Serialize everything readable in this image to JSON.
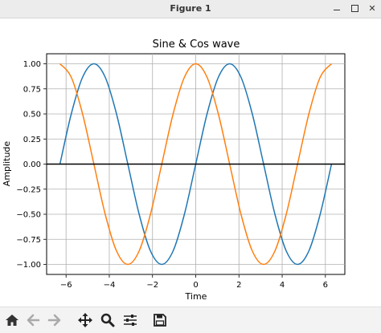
{
  "window": {
    "title": "Figure 1"
  },
  "toolbar": {
    "buttons": [
      {
        "name": "home-button",
        "icon": "home-icon"
      },
      {
        "name": "back-button",
        "icon": "arrow-left-icon"
      },
      {
        "name": "forward-button",
        "icon": "arrow-right-icon"
      },
      {
        "name": "pan-button",
        "icon": "move-icon"
      },
      {
        "name": "zoom-button",
        "icon": "magnifier-icon"
      },
      {
        "name": "configure-subplots-button",
        "icon": "sliders-icon"
      },
      {
        "name": "save-button",
        "icon": "floppy-disk-icon"
      }
    ]
  },
  "chart_data": {
    "type": "line",
    "title": "Sine & Cos wave",
    "xlabel": "Time",
    "ylabel": "Amplitude",
    "xlim": [
      -6.9,
      6.9
    ],
    "ylim": [
      -1.1,
      1.1
    ],
    "xticks": [
      -6,
      -4,
      -2,
      0,
      2,
      4,
      6
    ],
    "xtick_labels": [
      "−6",
      "−4",
      "−2",
      "0",
      "2",
      "4",
      "6"
    ],
    "yticks": [
      1.0,
      0.75,
      0.5,
      0.25,
      0.0,
      -0.25,
      -0.5,
      -0.75,
      -1.0
    ],
    "ytick_labels": [
      "1.00",
      "0.75",
      "0.50",
      "0.25",
      "0.00",
      "−0.25",
      "−0.50",
      "−0.75",
      "−1.00"
    ],
    "grid": true,
    "hline": {
      "y": 0,
      "color": "#000000"
    },
    "series": [
      {
        "color": "#1f77b4",
        "x": [
          -6.2832,
          -5.7596,
          -5.236,
          -4.7124,
          -4.1888,
          -3.6652,
          -3.1416,
          -2.618,
          -2.0944,
          -1.5708,
          -1.0472,
          -0.5236,
          0,
          0.5236,
          1.0472,
          1.5708,
          2.0944,
          2.618,
          3.1416,
          3.6652,
          4.1888,
          4.7124,
          5.236,
          5.7596,
          6.2832
        ],
        "y": [
          0,
          0.5,
          0.866,
          1,
          0.866,
          0.5,
          0,
          -0.5,
          -0.866,
          -1,
          -0.866,
          -0.5,
          0,
          0.5,
          0.866,
          1,
          0.866,
          0.5,
          0,
          -0.5,
          -0.866,
          -1,
          -0.866,
          -0.5,
          0
        ]
      },
      {
        "color": "#ff7f0e",
        "x": [
          -6.2832,
          -5.7596,
          -5.236,
          -4.7124,
          -4.1888,
          -3.6652,
          -3.1416,
          -2.618,
          -2.0944,
          -1.5708,
          -1.0472,
          -0.5236,
          0,
          0.5236,
          1.0472,
          1.5708,
          2.0944,
          2.618,
          3.1416,
          3.6652,
          4.1888,
          4.7124,
          5.236,
          5.7596,
          6.2832
        ],
        "y": [
          1,
          0.866,
          0.5,
          0,
          -0.5,
          -0.866,
          -1,
          -0.866,
          -0.5,
          0,
          0.5,
          0.866,
          1,
          0.866,
          0.5,
          0,
          -0.5,
          -0.866,
          -1,
          -0.866,
          -0.5,
          0,
          0.5,
          0.866,
          1
        ]
      }
    ]
  }
}
